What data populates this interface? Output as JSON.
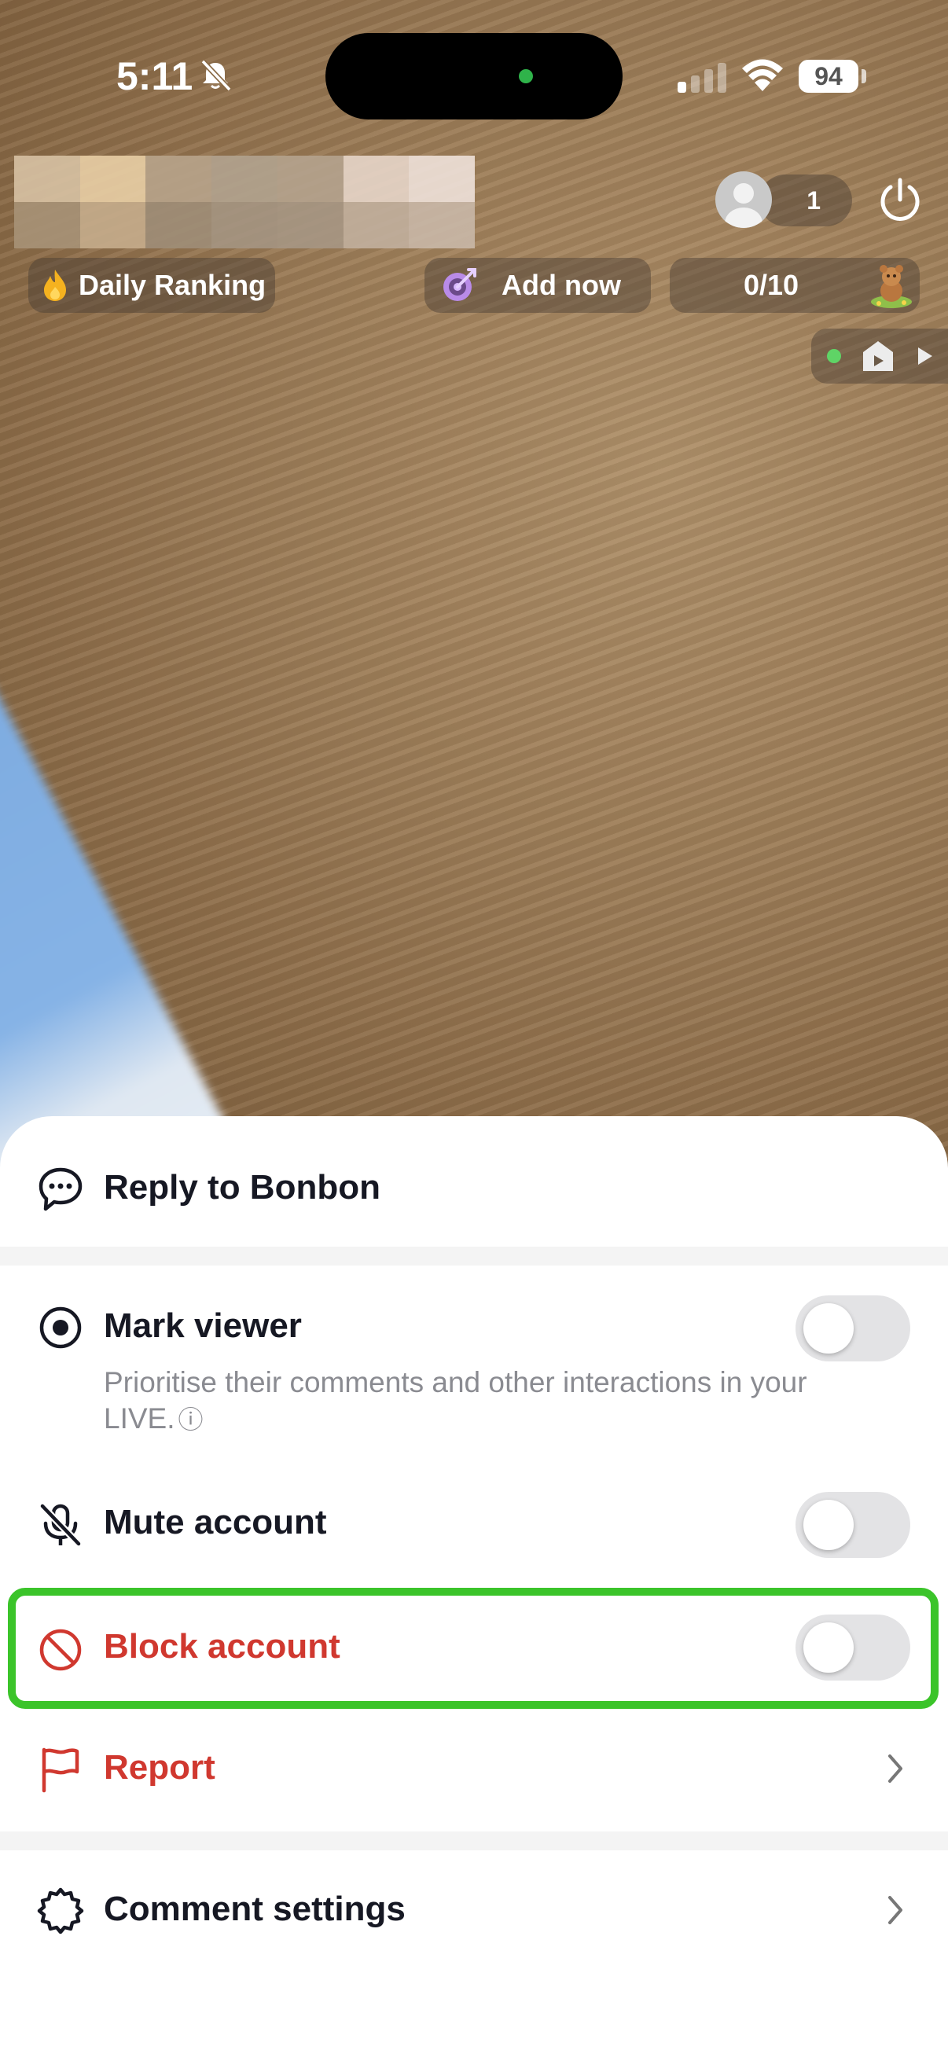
{
  "status_bar": {
    "time": "5:11",
    "battery": "94"
  },
  "top_overlay": {
    "viewer_count": "1",
    "daily_ranking_label": "Daily Ranking",
    "add_now_label": "Add now",
    "goal_progress": "0/10"
  },
  "sheet": {
    "reply_label": "Reply to Bonbon",
    "mark_viewer_label": "Mark viewer",
    "mark_viewer_desc": "Prioritise their comments and other interactions in your LIVE.",
    "mark_viewer_info_icon": "ⓘ",
    "mute_label": "Mute account",
    "block_label": "Block account",
    "report_label": "Report",
    "comment_settings_label": "Comment settings"
  },
  "toggles": {
    "mark_viewer": false,
    "mute_account": false,
    "block_account": false
  },
  "colors": {
    "danger": "#d0382f",
    "highlight": "#3bc42a",
    "toggle_off": "#e3e3e5"
  },
  "icons": {
    "reply": "chat-bubble-icon",
    "mark_viewer": "radio-target-icon",
    "mute": "mic-off-icon",
    "block": "block-icon",
    "report": "flag-icon",
    "comment_settings": "gear-icon"
  }
}
